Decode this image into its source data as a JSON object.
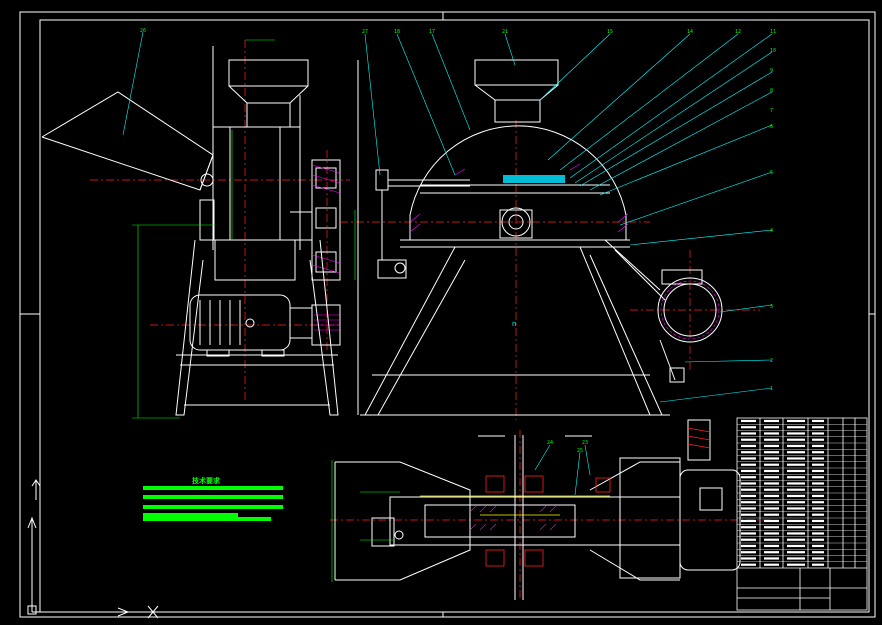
{
  "drawing": {
    "title": "",
    "background": "#000000",
    "colors": {
      "outline": "#ffffff",
      "leader": "#00ffff",
      "centerline": "#ff2020",
      "dimension": "#00ff00",
      "hatch": "#ff00ff",
      "highlight": "#00bcd4",
      "accent_yellow": "#ffff00",
      "title_block": "#ffffff"
    }
  },
  "watermark": {
    "text": "n"
  },
  "balloons": {
    "side_view": [
      "26"
    ],
    "front_view": [
      "27",
      "18",
      "17",
      "21",
      "15",
      "14",
      "12",
      "11",
      "10",
      "9",
      "8",
      "7",
      "6",
      "5",
      "4",
      "3",
      "2",
      "1"
    ],
    "top_view": [
      "24",
      "23",
      "25"
    ]
  },
  "technical_requirements": {
    "title": "技术要求",
    "lines_count": 4
  },
  "title_block": {
    "rows": 24,
    "columns": 6
  },
  "icons": [
    "ucs-icon",
    "grid-cross-icon",
    "north-arrow-icon"
  ]
}
